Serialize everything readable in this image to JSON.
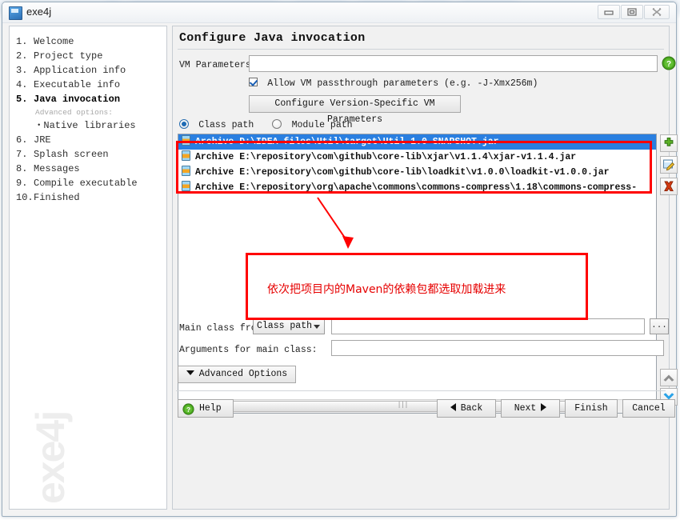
{
  "window": {
    "title": "exe4j",
    "app_icon": "exe4j-icon",
    "controls": {
      "minimize": "minimize-icon",
      "maximize": "maximize-icon",
      "close": "close-icon"
    }
  },
  "sidebar": {
    "watermark": "exe4j",
    "steps": [
      {
        "num": "1.",
        "label": "Welcome",
        "active": false
      },
      {
        "num": "2.",
        "label": "Project type",
        "active": false
      },
      {
        "num": "3.",
        "label": "Application info",
        "active": false
      },
      {
        "num": "4.",
        "label": "Executable info",
        "active": false
      },
      {
        "num": "5.",
        "label": "Java invocation",
        "active": true
      }
    ],
    "advanced_header": "Advanced options:",
    "substeps": [
      {
        "label": "Native libraries"
      }
    ],
    "steps_after": [
      {
        "num": "6.",
        "label": "JRE",
        "active": false
      },
      {
        "num": "7.",
        "label": "Splash screen",
        "active": false
      },
      {
        "num": "8.",
        "label": "Messages",
        "active": false
      },
      {
        "num": "9.",
        "label": "Compile executable",
        "active": false
      },
      {
        "num": "10.",
        "label": "Finished",
        "active": false
      }
    ]
  },
  "main": {
    "page_title": "Configure Java invocation",
    "vm_parameters": {
      "label": "VM Parameters:",
      "value": "",
      "placeholder": ""
    },
    "help_icon": "help-icon",
    "allow_passthrough": {
      "label": "Allow VM passthrough parameters (e.g. -J-Xmx256m)",
      "checked": true
    },
    "version_specific_button": "Configure Version-Specific VM Parameters",
    "path_mode": {
      "options": [
        {
          "label": "Class path",
          "selected": true
        },
        {
          "label": "Module path",
          "selected": false
        }
      ]
    },
    "classpath_list": {
      "icon": "jar-file-icon",
      "rows": [
        {
          "text": "Archive D:\\IDEA-files\\Util\\target\\Util-1.0-SNAPSHOT.jar",
          "selected": true
        },
        {
          "text": "Archive E:\\repository\\com\\github\\core-lib\\xjar\\v1.1.4\\xjar-v1.1.4.jar",
          "selected": false
        },
        {
          "text": "Archive E:\\repository\\com\\github\\core-lib\\loadkit\\v1.0.0\\loadkit-v1.0.0.jar",
          "selected": false
        },
        {
          "text": "Archive E:\\repository\\org\\apache\\commons\\commons-compress\\1.18\\commons-compress-",
          "selected": false
        }
      ]
    },
    "list_buttons": {
      "add": "add-icon",
      "edit": "edit-icon",
      "delete": "delete-icon",
      "move_up": "chevron-up-icon",
      "move_down": "chevron-down-icon"
    },
    "scrollbar": {
      "left_arrow": "◄",
      "right_arrow": "►",
      "grip": "|||"
    },
    "main_class": {
      "label": "Main class from",
      "combo_value": "Class path",
      "input_value": "",
      "browse_label": "..."
    },
    "arguments": {
      "label": "Arguments for main class:",
      "value": ""
    },
    "advanced_options_button": "Advanced Options"
  },
  "footer": {
    "help": "Help",
    "back": "Back",
    "next": "Next",
    "finish": "Finish",
    "cancel": "Cancel"
  },
  "annotations": {
    "note_text": "依次把项目内的Maven的依赖包都选取加载进来",
    "highlight_color": "#ff0000"
  }
}
